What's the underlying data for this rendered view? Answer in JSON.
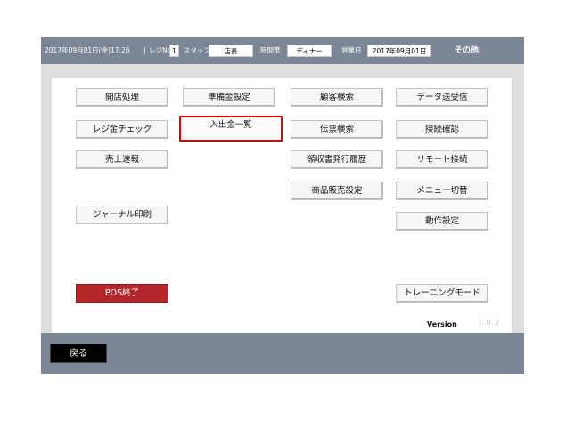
{
  "header": {
    "datetime": "2017年09月01日(金)17:26",
    "register_label": "レジNo",
    "register_no": "1",
    "staff_label": "スタッフ",
    "staff_value": "店長",
    "timeslot_label": "時間帯",
    "timeslot_value": "ディナー",
    "business_day_label": "営業日",
    "business_day_value": "2017年09月01日",
    "other_label": "その他"
  },
  "menu": {
    "open_store": "開店処理",
    "register_check": "レジ金チェック",
    "sales_report": "売上速報",
    "journal_print": "ジャーナル印刷",
    "pos_exit": "POS終了",
    "float_setting": "準備金設定",
    "cash_in_out_list": "入出金一覧",
    "customer_search": "顧客検索",
    "slip_search": "伝票検索",
    "receipt_history": "領収書発行履歴",
    "product_sales_setting": "商品販売設定",
    "data_send_receive": "データ送受信",
    "connection_check": "接続確認",
    "remote_connect": "リモート接続",
    "menu_switch": "メニュー切替",
    "operation_setting": "動作設定",
    "training_mode": "トレーニングモード"
  },
  "version": {
    "label": "Version",
    "value": "1.0.2"
  },
  "footer": {
    "back_label": "戻る"
  },
  "colors": {
    "header_bg": "#7b8696",
    "highlight_border": "#e00000",
    "exit_button_bg": "#b5262a"
  }
}
